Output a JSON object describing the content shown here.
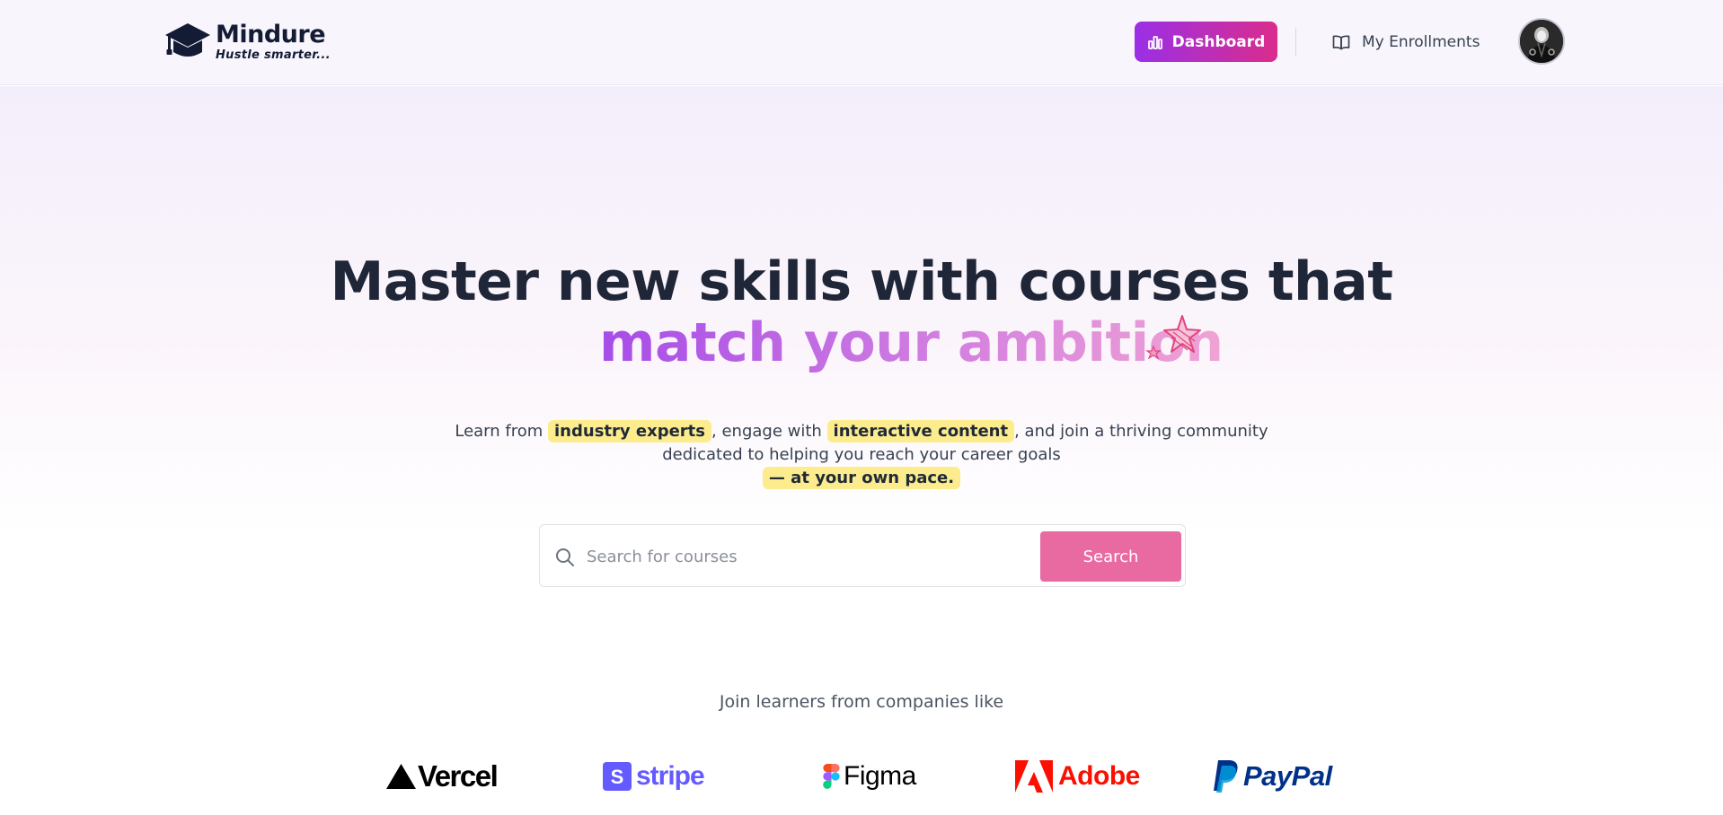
{
  "brand": {
    "name": "Mindure",
    "tagline": "Hustle smarter..."
  },
  "nav": {
    "dashboard_label": "Dashboard",
    "enrollments_label": "My Enrollments"
  },
  "hero": {
    "headline_line1": "Master new skills with courses that",
    "headline_line2": "match your ambition",
    "sub_prefix": "Learn from",
    "sub_highlight1": "industry experts",
    "sub_mid": ", engage with",
    "sub_highlight2": "interactive content",
    "sub_suffix": ", and join a thriving community",
    "sub_line2": "dedicated to helping you reach your career goals",
    "sub_highlight3": "— at your own pace."
  },
  "search": {
    "placeholder": "Search for courses",
    "value": "",
    "button_label": "Search"
  },
  "companies": {
    "heading": "Join learners from companies like",
    "items": [
      "Vercel",
      "stripe",
      "Figma",
      "Adobe",
      "PayPal"
    ]
  },
  "colors": {
    "accent_purple": "#9a2fe6",
    "accent_pink": "#db2c8c",
    "search_button": "#e96aa1",
    "highlight": "#fdec8e"
  }
}
